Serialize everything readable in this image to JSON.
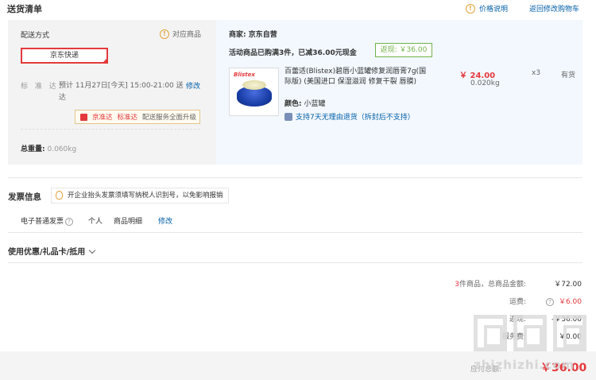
{
  "header": {
    "title": "送货清单",
    "price_note": "价格说明",
    "back_link": "返回修改购物车"
  },
  "shipping": {
    "label": "配送方式",
    "match_link": "对应商品",
    "express": "京东快递",
    "standard_label": "标 准 达:",
    "standard_time": "预计 11月27日[今天] 15:00-21:00 送达",
    "modify": "修改",
    "promo_badge1": "京准达",
    "promo_badge2": "标准达",
    "promo_desc": "配送服务全面升级",
    "total_weight_label": "总重量:",
    "total_weight_value": "0.060kg"
  },
  "order": {
    "merchant": "商家: 京东自营",
    "promo_line": "活动商品已购满3件，已减36.00元现金",
    "return_tag": "返现: ￥36.00",
    "product": {
      "brand_text": "Blistex",
      "name": "百蕾适(Blistex)碧唇小蓝罐修复润唇膏7g(国际版) (美国进口 保湿滋润 修复干裂 唇膜)",
      "color_label": "颜色:",
      "color_value": "小蓝罐",
      "return_policy": "支持7天无理由退货（拆封后不支持）",
      "price": "￥ 24.00",
      "weight": "0.020kg",
      "qty": "x3",
      "stock": "有货"
    }
  },
  "invoice": {
    "title": "发票信息",
    "tip": "开企业抬头发票须填写纳税人识别号，以免影响报销",
    "type": "电子普通发票",
    "personal": "个人",
    "detail": "商品明细",
    "modify": "修改"
  },
  "coupon": {
    "title": "使用优惠/礼品卡/抵用"
  },
  "summary": {
    "count": "3",
    "count_suffix": "件商品，总商品金额:",
    "total": "￥72.00",
    "freight_label": "运费:",
    "freight": "￥6.00",
    "cashback_label": "返现:",
    "cashback": "-￥36.00",
    "service_label": "服务费:",
    "service": "￥0.00",
    "payable_label": "应付总额:",
    "payable": "￥36.00"
  },
  "watermark": {
    "text": "zhizhizhi.com"
  },
  "colors": {
    "accent_red": "#e4393c",
    "link_blue": "#005ea7",
    "green": "#71b247",
    "orange": "#e4a33a"
  }
}
